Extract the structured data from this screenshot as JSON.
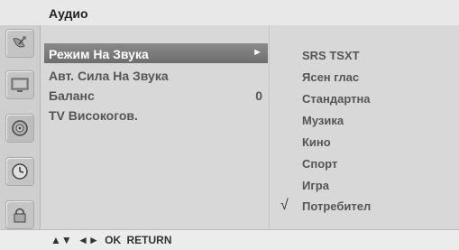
{
  "header": {
    "title": "Аудио"
  },
  "sidebar": {
    "icons": [
      "satellite-dish-icon",
      "monitor-icon",
      "speaker-icon",
      "clock-icon",
      "lock-icon"
    ]
  },
  "menu": {
    "items": [
      {
        "label": "Режим На Звука",
        "value": "►",
        "selected": true
      },
      {
        "label": "Авт. Сила На Звука",
        "value": ""
      },
      {
        "label": "Баланс",
        "value": "0"
      },
      {
        "label": "TV Високогов.",
        "value": ""
      }
    ]
  },
  "submenu": {
    "items": [
      "SRS TSXT",
      "Ясен глас",
      "Стандартна",
      "Музика",
      "Кино",
      "Спорт",
      "Игра",
      "Потребител"
    ],
    "checked_mark": "√"
  },
  "footer": {
    "hints": "▲▼ ◄► OK RETURN"
  }
}
